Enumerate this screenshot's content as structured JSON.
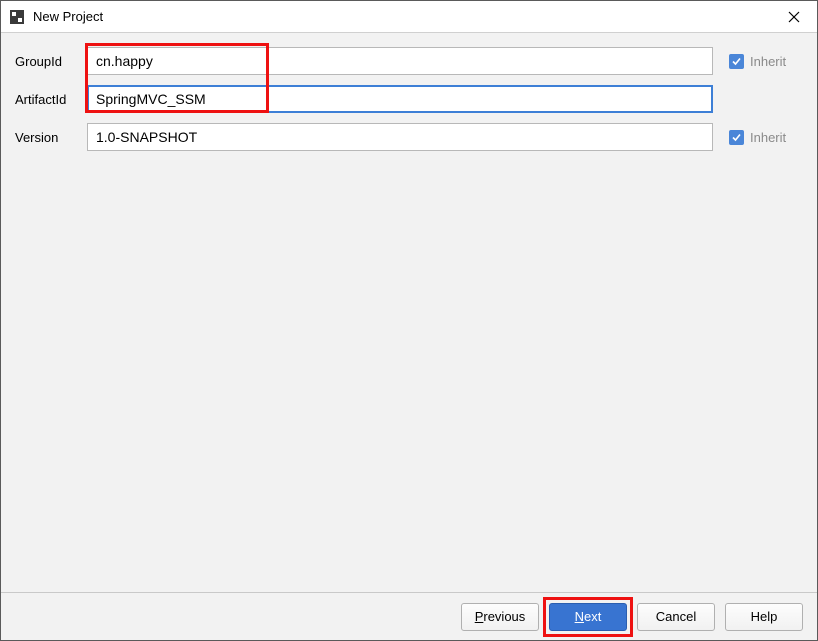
{
  "window": {
    "title": "New Project"
  },
  "form": {
    "groupid_label": "GroupId",
    "groupid_value": "cn.happy",
    "artifactid_label": "ArtifactId",
    "artifactid_value": "SpringMVC_SSM",
    "version_label": "Version",
    "version_value": "1.0-SNAPSHOT",
    "inherit_label": "Inherit"
  },
  "footer": {
    "previous": "Previous",
    "next": "Next",
    "cancel": "Cancel",
    "help": "Help"
  }
}
